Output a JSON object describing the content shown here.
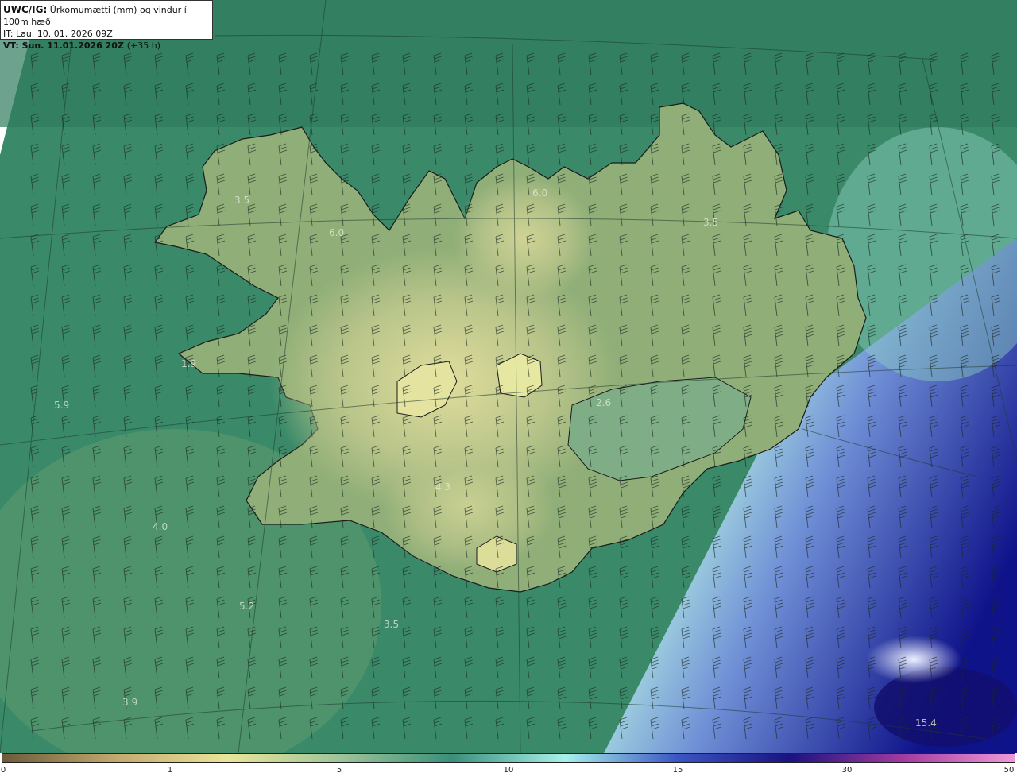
{
  "header": {
    "line1_bold": "UWC/IG:",
    "line1_text": "Úrkomumætti (mm) og vindur í 100m hæð",
    "line2": "IT: Lau. 10. 01. 2026 09Z",
    "line3_bold": "VT: Sun. 11.01.2026 20Z",
    "line3_rest": "(+35 h)"
  },
  "map_values": [
    "3.5",
    "6.0",
    "6.0",
    "3.5",
    "1.9",
    "5.9",
    "2.6",
    "4.3",
    "4.0",
    "5.2",
    "3.5",
    "3.9",
    "15.4"
  ],
  "colorbar": {
    "ticks": [
      "0",
      "1",
      "5",
      "10",
      "15",
      "30",
      "50"
    ],
    "colors": [
      "#6b5a3c",
      "#c2a86e",
      "#e9e59a",
      "#9fc49a",
      "#3a8f7a",
      "#a8f0ea",
      "#3b55c4",
      "#1a1280",
      "#a23a9e",
      "#ef9ad8"
    ]
  },
  "map_colors": {
    "sea_green": "#2e7a5e",
    "highland": "#c8c885",
    "light_cyan": "#c7f2ef",
    "deep_blue": "#141a8c"
  }
}
